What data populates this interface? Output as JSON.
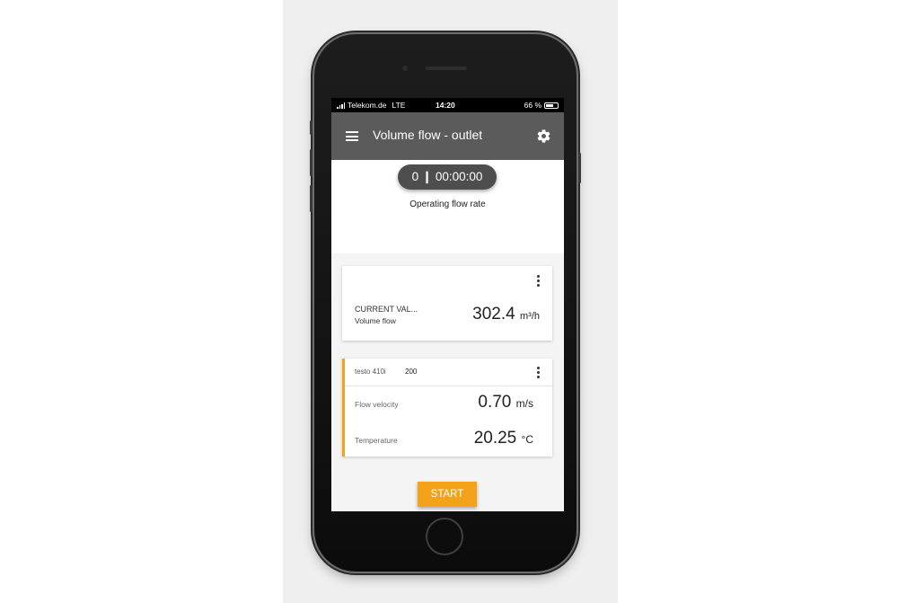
{
  "status_bar": {
    "carrier": "Telekom.de",
    "network": "LTE",
    "time": "14:20",
    "battery": "66 %",
    "battery_level": 0.66
  },
  "app_bar": {
    "title": "Volume flow - outlet",
    "menu_icon": "hamburger-menu-icon",
    "settings_icon": "gear-icon"
  },
  "timer": {
    "display": "0 ❙ 00:00:00",
    "label": "Operating flow rate"
  },
  "current_value_card": {
    "heading": "CURRENT VAL...",
    "subheading": "Volume flow",
    "value": "302.4",
    "unit": "m³/h",
    "menu_icon": "kebab-menu-icon"
  },
  "device_card": {
    "device_name": "testo 410i",
    "device_id": "200",
    "menu_icon": "kebab-menu-icon",
    "accent_color": "#f3a21a",
    "rows": [
      {
        "label": "Flow velocity",
        "value": "0.70",
        "unit": "m/s"
      },
      {
        "label": "Temperature",
        "value": "20.25",
        "unit": "°C"
      }
    ]
  },
  "start_button": {
    "label": "START",
    "color": "#f3a21a"
  },
  "colors": {
    "app_bar": "#5b5b5b",
    "accent": "#f3a21a",
    "timer_pill": "#4e4e4e"
  }
}
